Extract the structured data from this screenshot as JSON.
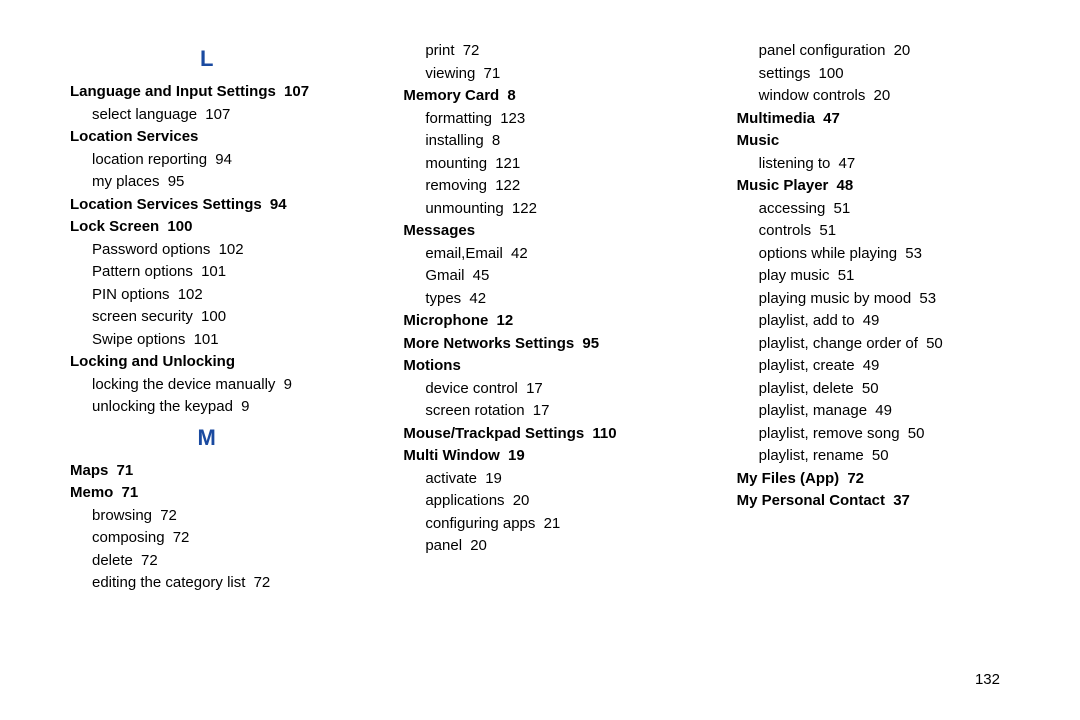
{
  "page_number": "132",
  "columns": [
    [
      {
        "type": "letter",
        "text": "L"
      },
      {
        "type": "head",
        "label": "Language and Input Settings",
        "page": "107"
      },
      {
        "type": "sub",
        "label": "select language",
        "page": "107"
      },
      {
        "type": "head",
        "label": "Location Services",
        "page": ""
      },
      {
        "type": "sub",
        "label": "location reporting",
        "page": "94"
      },
      {
        "type": "sub",
        "label": "my places",
        "page": "95"
      },
      {
        "type": "head",
        "label": "Location Services Settings",
        "page": "94"
      },
      {
        "type": "head",
        "label": "Lock Screen",
        "page": "100"
      },
      {
        "type": "sub",
        "label": "Password options",
        "page": "102"
      },
      {
        "type": "sub",
        "label": "Pattern options",
        "page": "101"
      },
      {
        "type": "sub",
        "label": "PIN options",
        "page": "102"
      },
      {
        "type": "sub",
        "label": "screen security",
        "page": "100"
      },
      {
        "type": "sub",
        "label": "Swipe options",
        "page": "101"
      },
      {
        "type": "head",
        "label": "Locking and Unlocking",
        "page": ""
      },
      {
        "type": "sub",
        "label": "locking the device manually",
        "page": "9"
      },
      {
        "type": "sub",
        "label": "unlocking the keypad",
        "page": "9"
      },
      {
        "type": "letter",
        "text": "M"
      },
      {
        "type": "head",
        "label": "Maps",
        "page": "71"
      },
      {
        "type": "head",
        "label": "Memo",
        "page": "71"
      },
      {
        "type": "sub",
        "label": "browsing",
        "page": "72"
      },
      {
        "type": "sub",
        "label": "composing",
        "page": "72"
      },
      {
        "type": "sub",
        "label": "delete",
        "page": "72"
      },
      {
        "type": "sub",
        "label": "editing the category list",
        "page": "72"
      }
    ],
    [
      {
        "type": "sub",
        "label": "print",
        "page": "72"
      },
      {
        "type": "sub",
        "label": "viewing",
        "page": "71"
      },
      {
        "type": "head",
        "label": "Memory Card",
        "page": "8"
      },
      {
        "type": "sub",
        "label": "formatting",
        "page": "123"
      },
      {
        "type": "sub",
        "label": "installing",
        "page": "8"
      },
      {
        "type": "sub",
        "label": "mounting",
        "page": "121"
      },
      {
        "type": "sub",
        "label": "removing",
        "page": "122"
      },
      {
        "type": "sub",
        "label": "unmounting",
        "page": "122"
      },
      {
        "type": "head",
        "label": "Messages",
        "page": ""
      },
      {
        "type": "sub",
        "label": "email,Email",
        "page": "42"
      },
      {
        "type": "sub",
        "label": "Gmail",
        "page": "45"
      },
      {
        "type": "sub",
        "label": "types",
        "page": "42"
      },
      {
        "type": "head",
        "label": "Microphone",
        "page": "12"
      },
      {
        "type": "head",
        "label": "More Networks Settings",
        "page": "95"
      },
      {
        "type": "head",
        "label": "Motions",
        "page": ""
      },
      {
        "type": "sub",
        "label": "device control",
        "page": "17"
      },
      {
        "type": "sub",
        "label": "screen rotation",
        "page": "17"
      },
      {
        "type": "head",
        "label": "Mouse/Trackpad Settings",
        "page": "110"
      },
      {
        "type": "head",
        "label": "Multi Window",
        "page": "19"
      },
      {
        "type": "sub",
        "label": "activate",
        "page": "19"
      },
      {
        "type": "sub",
        "label": "applications",
        "page": "20"
      },
      {
        "type": "sub",
        "label": "configuring apps",
        "page": "21"
      },
      {
        "type": "sub",
        "label": "panel",
        "page": "20"
      }
    ],
    [
      {
        "type": "sub",
        "label": "panel configuration",
        "page": "20"
      },
      {
        "type": "sub",
        "label": "settings",
        "page": "100"
      },
      {
        "type": "sub",
        "label": "window controls",
        "page": "20"
      },
      {
        "type": "head",
        "label": "Multimedia",
        "page": "47"
      },
      {
        "type": "head",
        "label": "Music",
        "page": ""
      },
      {
        "type": "sub",
        "label": "listening to",
        "page": "47"
      },
      {
        "type": "head",
        "label": "Music Player",
        "page": "48"
      },
      {
        "type": "sub",
        "label": "accessing",
        "page": "51"
      },
      {
        "type": "sub",
        "label": "controls",
        "page": "51"
      },
      {
        "type": "sub",
        "label": "options while playing",
        "page": "53"
      },
      {
        "type": "sub",
        "label": "play music",
        "page": "51"
      },
      {
        "type": "sub",
        "label": "playing music by mood",
        "page": "53"
      },
      {
        "type": "sub",
        "label": "playlist, add to",
        "page": "49"
      },
      {
        "type": "sub",
        "label": "playlist, change order of",
        "page": "50"
      },
      {
        "type": "sub",
        "label": "playlist, create",
        "page": "49"
      },
      {
        "type": "sub",
        "label": "playlist, delete",
        "page": "50"
      },
      {
        "type": "sub",
        "label": "playlist, manage",
        "page": "49"
      },
      {
        "type": "sub",
        "label": "playlist, remove song",
        "page": "50"
      },
      {
        "type": "sub",
        "label": "playlist, rename",
        "page": "50"
      },
      {
        "type": "head",
        "label": "My Files (App)",
        "page": "72"
      },
      {
        "type": "head",
        "label": "My Personal Contact",
        "page": "37"
      }
    ]
  ]
}
